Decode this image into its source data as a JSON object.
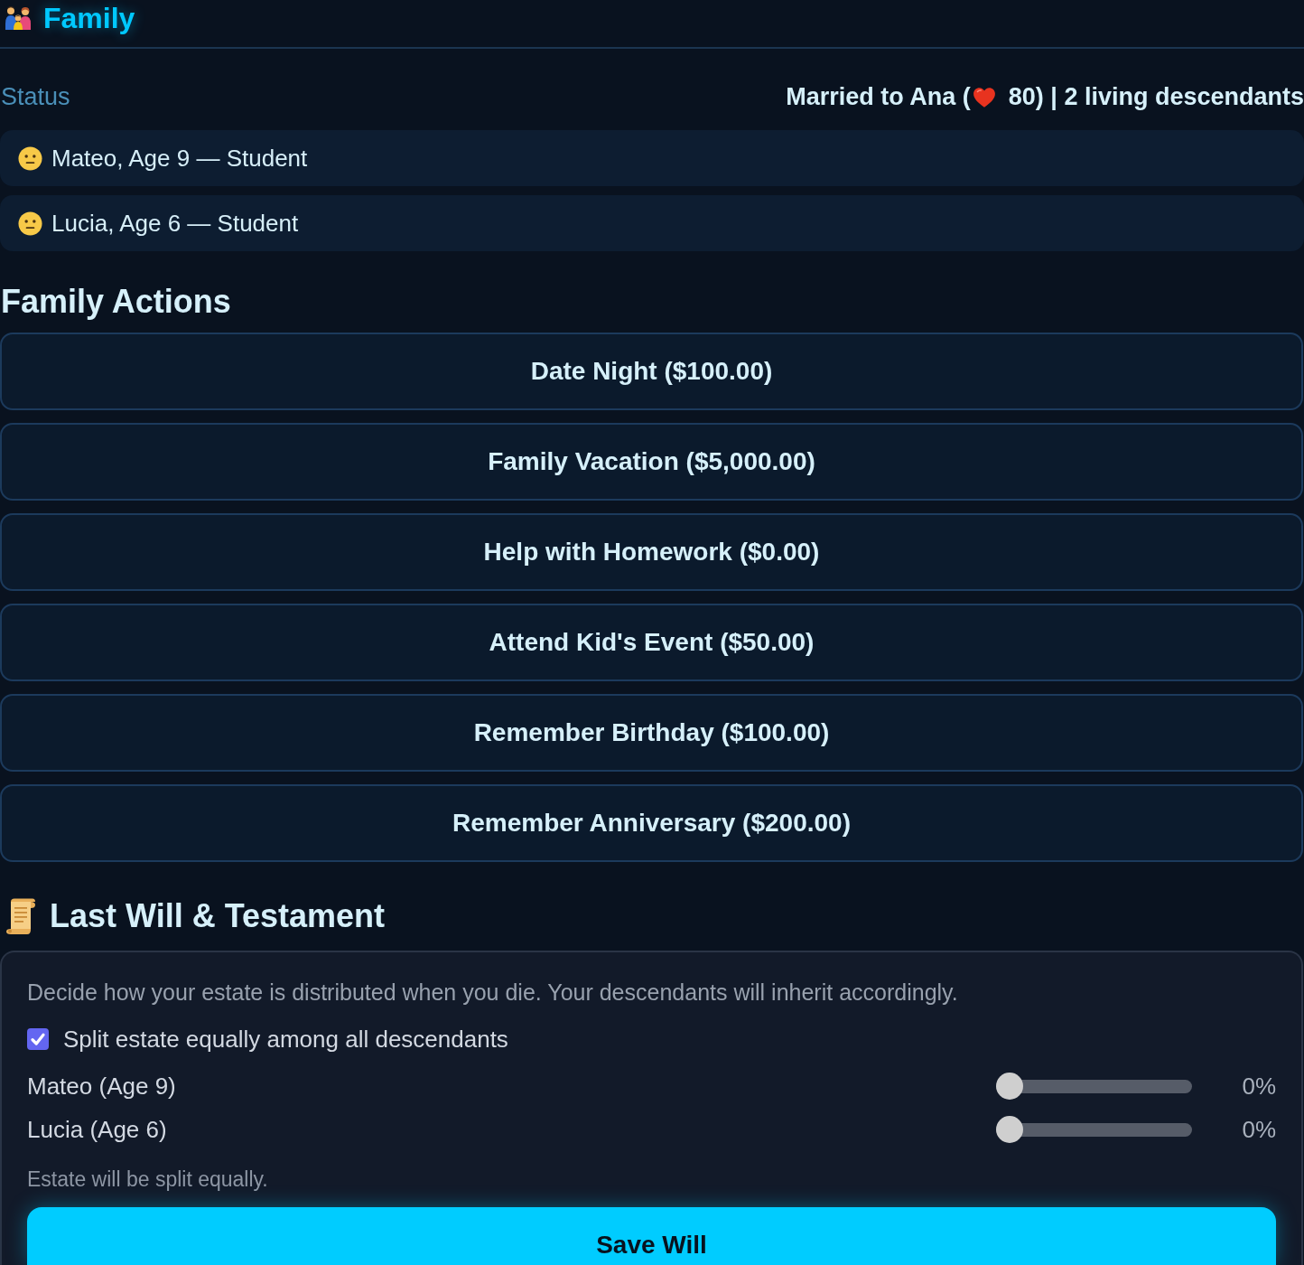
{
  "header": {
    "title": "Family"
  },
  "status": {
    "label": "Status",
    "value_before": "Married to Ana (",
    "value_after": "80) | 2 living descendants"
  },
  "children": [
    {
      "name": "Mateo, Age 9 — Student"
    },
    {
      "name": "Lucia, Age 6 — Student"
    }
  ],
  "actions": {
    "title": "Family Actions",
    "buttons": [
      "Date Night ($100.00)",
      "Family Vacation ($5,000.00)",
      "Help with Homework ($0.00)",
      "Attend Kid's Event ($50.00)",
      "Remember Birthday ($100.00)",
      "Remember Anniversary ($200.00)"
    ]
  },
  "will": {
    "title": "Last Will & Testament",
    "description": "Decide how your estate is distributed when you die. Your descendants will inherit accordingly.",
    "split_equally": {
      "label": "Split estate equally among all descendants",
      "checked": true
    },
    "heirs": [
      {
        "name": "Mateo (Age 9)",
        "level": 0,
        "reading": "0%"
      },
      {
        "name": "Lucia (Age 6)",
        "level": 0,
        "reading": "0%"
      }
    ],
    "note": "Estate will be split equally.",
    "save_button": "Save Will"
  }
}
